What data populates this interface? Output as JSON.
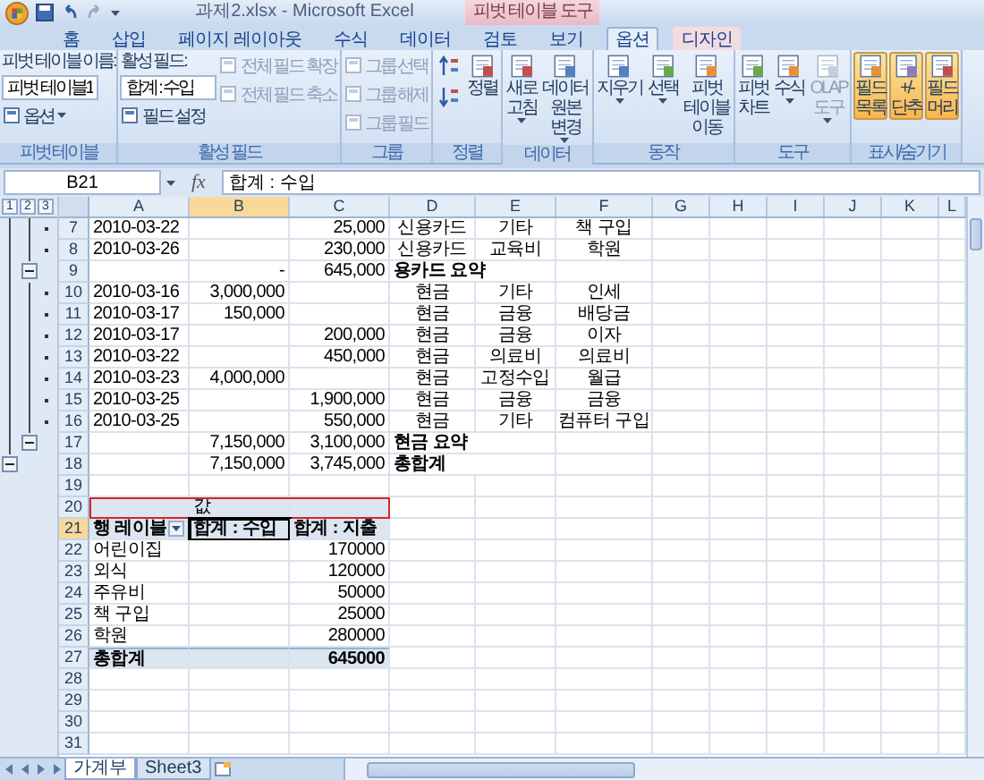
{
  "window": {
    "title": "과제2.xlsx - Microsoft Excel",
    "context_label": "피벗 테이블 도구"
  },
  "tabs": [
    {
      "label": "홈",
      "selected": false,
      "contextual": false
    },
    {
      "label": "삽입",
      "selected": false,
      "contextual": false
    },
    {
      "label": "페이지 레이아웃",
      "selected": false,
      "contextual": false
    },
    {
      "label": "수식",
      "selected": false,
      "contextual": false
    },
    {
      "label": "데이터",
      "selected": false,
      "contextual": false
    },
    {
      "label": "검토",
      "selected": false,
      "contextual": false
    },
    {
      "label": "보기",
      "selected": false,
      "contextual": false
    },
    {
      "label": "옵션",
      "selected": true,
      "contextual": true
    },
    {
      "label": "디자인",
      "selected": false,
      "contextual": true
    }
  ],
  "ribbon": {
    "groups": [
      {
        "name": "피벗 테이블",
        "columns": [
          [
            {
              "kind": "caption",
              "label": "피벗 테이블 이름:"
            },
            {
              "kind": "field",
              "value": "피벗 테이블1"
            },
            {
              "kind": "small",
              "label": "옵션",
              "dropdown": true,
              "disabled": false
            }
          ]
        ]
      },
      {
        "name": "활성 필드",
        "columns": [
          [
            {
              "kind": "caption",
              "label": "활성 필드:"
            },
            {
              "kind": "field",
              "value": "합계 : 수입"
            },
            {
              "kind": "small",
              "label": "필드 설정",
              "dropdown": false,
              "disabled": false
            }
          ],
          [
            {
              "kind": "small",
              "label": "전체 필드 확장",
              "dropdown": false,
              "disabled": true
            },
            {
              "kind": "small",
              "label": "전체 필드 축소",
              "dropdown": false,
              "disabled": true
            }
          ]
        ]
      },
      {
        "name": "그룹",
        "columns": [
          [
            {
              "kind": "small",
              "label": "그룹 선택",
              "dropdown": false,
              "disabled": true
            },
            {
              "kind": "small",
              "label": "그룹 해제",
              "dropdown": false,
              "disabled": true
            },
            {
              "kind": "small",
              "label": "그룹 필드",
              "dropdown": false,
              "disabled": true
            }
          ]
        ]
      },
      {
        "name": "정렬",
        "columns": [
          [
            {
              "kind": "sort-ascending"
            },
            {
              "kind": "sort-descending"
            }
          ],
          [
            {
              "kind": "large",
              "label": "정렬",
              "dropdown": false,
              "disabled": false,
              "on": false
            }
          ]
        ]
      },
      {
        "name": "데이터",
        "columns": [
          [
            {
              "kind": "large",
              "label": "새로 고침",
              "dropdown": true,
              "disabled": false,
              "on": false
            }
          ],
          [
            {
              "kind": "large",
              "label": "데이터 원본 변경",
              "dropdown": true,
              "disabled": false,
              "on": false
            }
          ]
        ]
      },
      {
        "name": "동작",
        "columns": [
          [
            {
              "kind": "large",
              "label": "지우기",
              "dropdown": true,
              "disabled": false,
              "on": false
            }
          ],
          [
            {
              "kind": "large",
              "label": "선택",
              "dropdown": true,
              "disabled": false,
              "on": false
            }
          ],
          [
            {
              "kind": "large",
              "label": "피벗 테이블 이동",
              "dropdown": false,
              "disabled": false,
              "on": false
            }
          ]
        ]
      },
      {
        "name": "도구",
        "columns": [
          [
            {
              "kind": "large",
              "label": "피벗 차트",
              "dropdown": false,
              "disabled": false,
              "on": false
            }
          ],
          [
            {
              "kind": "large",
              "label": "수식",
              "dropdown": true,
              "disabled": false,
              "on": false
            }
          ],
          [
            {
              "kind": "large",
              "label": "OLAP 도구",
              "dropdown": true,
              "disabled": true,
              "on": false
            }
          ]
        ]
      },
      {
        "name": "표시/숨기기",
        "columns": [
          [
            {
              "kind": "large",
              "label": "필드 목록",
              "dropdown": false,
              "disabled": false,
              "on": true
            }
          ],
          [
            {
              "kind": "large",
              "label": "+/- 단추",
              "dropdown": false,
              "disabled": false,
              "on": true
            }
          ],
          [
            {
              "kind": "large",
              "label": "필드 머리",
              "dropdown": false,
              "disabled": false,
              "on": true
            }
          ]
        ]
      }
    ]
  },
  "formula_bar": {
    "name_box": "B21",
    "function_label": "fx",
    "formula": "합계 : 수입"
  },
  "outline_levels": [
    "1",
    "2",
    "3"
  ],
  "columns": [
    {
      "label": "A",
      "selected": false
    },
    {
      "label": "B",
      "selected": true
    },
    {
      "label": "C",
      "selected": false
    },
    {
      "label": "D",
      "selected": false
    },
    {
      "label": "E",
      "selected": false
    },
    {
      "label": "F",
      "selected": false
    },
    {
      "label": "G",
      "selected": false
    },
    {
      "label": "H",
      "selected": false
    },
    {
      "label": "I",
      "selected": false
    },
    {
      "label": "J",
      "selected": false
    },
    {
      "label": "K",
      "selected": false
    },
    {
      "label": "L",
      "selected": false
    }
  ],
  "rows": [
    {
      "number": "7",
      "selected": false,
      "kind": "record",
      "outline": {
        "kind": "dot"
      },
      "cells": {
        "a": "2010-03-22",
        "c": "25,000",
        "d": "신용카드",
        "e": "기타",
        "f": "책 구입"
      }
    },
    {
      "number": "8",
      "selected": false,
      "kind": "record",
      "outline": {
        "kind": "dot"
      },
      "cells": {
        "a": "2010-03-26",
        "c": "230,000",
        "d": "신용카드",
        "e": "교육비",
        "f": "학원"
      }
    },
    {
      "number": "9",
      "selected": false,
      "kind": "summary",
      "outline": {
        "kind": "group-minus"
      },
      "cells": {
        "b": "-",
        "c": "645,000",
        "d": "용카드 요약"
      }
    },
    {
      "number": "10",
      "selected": false,
      "kind": "record",
      "outline": {
        "kind": "dot"
      },
      "cells": {
        "a": "2010-03-16",
        "b": "3,000,000",
        "d": "현금",
        "e": "기타",
        "f": "인세"
      }
    },
    {
      "number": "11",
      "selected": false,
      "kind": "record",
      "outline": {
        "kind": "dot"
      },
      "cells": {
        "a": "2010-03-17",
        "b": "150,000",
        "d": "현금",
        "e": "금융",
        "f": "배당금"
      }
    },
    {
      "number": "12",
      "selected": false,
      "kind": "record",
      "outline": {
        "kind": "dot"
      },
      "cells": {
        "a": "2010-03-17",
        "c": "200,000",
        "d": "현금",
        "e": "금융",
        "f": "이자"
      }
    },
    {
      "number": "13",
      "selected": false,
      "kind": "record",
      "outline": {
        "kind": "dot"
      },
      "cells": {
        "a": "2010-03-22",
        "c": "450,000",
        "d": "현금",
        "e": "의료비",
        "f": "의료비"
      }
    },
    {
      "number": "14",
      "selected": false,
      "kind": "record",
      "outline": {
        "kind": "dot"
      },
      "cells": {
        "a": "2010-03-23",
        "b": "4,000,000",
        "d": "현금",
        "e": "고정수입",
        "f": "월급"
      }
    },
    {
      "number": "15",
      "selected": false,
      "kind": "record",
      "outline": {
        "kind": "dot"
      },
      "cells": {
        "a": "2010-03-25",
        "c": "1,900,000",
        "d": "현금",
        "e": "금융",
        "f": "금융"
      }
    },
    {
      "number": "16",
      "selected": false,
      "kind": "record",
      "outline": {
        "kind": "dot"
      },
      "cells": {
        "a": "2010-03-25",
        "c": "550,000",
        "d": "현금",
        "e": "기타",
        "f": "컴퓨터 구입"
      }
    },
    {
      "number": "17",
      "selected": false,
      "kind": "summary",
      "outline": {
        "kind": "group-minus"
      },
      "cells": {
        "b": "7,150,000",
        "c": "3,100,000",
        "d": "현금 요약"
      }
    },
    {
      "number": "18",
      "selected": false,
      "kind": "summary",
      "outline": {
        "kind": "total-minus"
      },
      "cells": {
        "b": "7,150,000",
        "c": "3,745,000",
        "d": "총합계"
      }
    },
    {
      "number": "19",
      "selected": false,
      "kind": "blank",
      "cells": {}
    },
    {
      "number": "20",
      "selected": false,
      "kind": "pivot-caption",
      "annotated": true,
      "cells": {
        "b": "값"
      }
    },
    {
      "number": "21",
      "selected": true,
      "kind": "pivot-header",
      "active": {
        "a": false,
        "b": true,
        "c": false
      },
      "cells": {
        "a": "행 레이블",
        "b": "합계 : 수입",
        "c": "합계 : 지출"
      }
    },
    {
      "number": "22",
      "selected": false,
      "kind": "pivot-item",
      "cells": {
        "a": "어린이집",
        "c": "170000"
      }
    },
    {
      "number": "23",
      "selected": false,
      "kind": "pivot-item",
      "cells": {
        "a": "외식",
        "c": "120000"
      }
    },
    {
      "number": "24",
      "selected": false,
      "kind": "pivot-item",
      "cells": {
        "a": "주유비",
        "c": "50000"
      }
    },
    {
      "number": "25",
      "selected": false,
      "kind": "pivot-item",
      "cells": {
        "a": "책 구입",
        "c": "25000"
      }
    },
    {
      "number": "26",
      "selected": false,
      "kind": "pivot-item",
      "cells": {
        "a": "학원",
        "c": "280000"
      }
    },
    {
      "number": "27",
      "selected": false,
      "kind": "pivot-total",
      "cells": {
        "a": "총합계",
        "c": "645000"
      }
    },
    {
      "number": "28",
      "selected": false,
      "kind": "blank",
      "cells": {}
    },
    {
      "number": "29",
      "selected": false,
      "kind": "blank",
      "cells": {}
    },
    {
      "number": "30",
      "selected": false,
      "kind": "blank",
      "cells": {}
    },
    {
      "number": "31",
      "selected": false,
      "kind": "blank",
      "cells": {}
    }
  ],
  "sheet_tabs": [
    {
      "label": "가계부",
      "selected": true
    },
    {
      "label": "Sheet3",
      "selected": false
    }
  ]
}
